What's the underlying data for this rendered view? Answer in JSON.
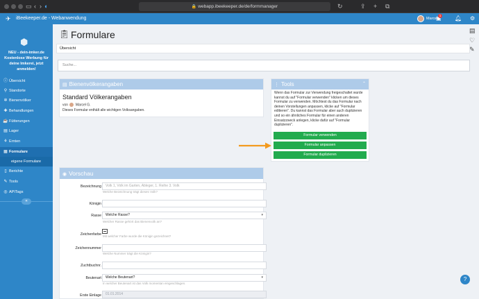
{
  "browser": {
    "url": "webapp.ibeekeeper.de/de/formmanager"
  },
  "header": {
    "app_name": "iBeekeeper.de - Webanwendung",
    "user_name": "Marcel",
    "notification_count": "1"
  },
  "sidebar": {
    "promo": "NEU - dein-imker.de Kostenlose Werbung für deine Imkerei, jetzt anmelden!",
    "items": [
      {
        "label": "Übersicht",
        "icon": "info-icon"
      },
      {
        "label": "Standorte",
        "icon": "map-pin-icon"
      },
      {
        "label": "Bienenvölker",
        "icon": "bee-icon"
      },
      {
        "label": "Behandlungen",
        "icon": "medkit-icon"
      },
      {
        "label": "Fütterungen",
        "icon": "feeding-icon"
      },
      {
        "label": "Lager",
        "icon": "warehouse-icon"
      },
      {
        "label": "Ernten",
        "icon": "harvest-icon"
      },
      {
        "label": "Formulare",
        "icon": "clipboard-icon"
      },
      {
        "label": "eigene Formulare",
        "icon": ""
      },
      {
        "label": "Berichte",
        "icon": "document-icon"
      },
      {
        "label": "Tools",
        "icon": "wrench-icon"
      },
      {
        "label": "APITags",
        "icon": "tag-icon"
      }
    ]
  },
  "main": {
    "title": "Formulare",
    "tab": "Übersicht",
    "search_placeholder": "Suche...",
    "bienen_card": {
      "header": "Bienenvölkerangaben",
      "form_title": "Standard Völkerangaben",
      "from_prefix": "von",
      "author": "Marcel G.",
      "description": "Dieses Formular enthält alle wichtigen Volksangaben."
    },
    "tools_card": {
      "header": "Tools",
      "text": "Wenn das Formular zur Verwendung freigeschaltet wurde kannst du auf \"Formular verwenden\" klicken um dieses Formular zu verwenden. Möchtest du das Formular nach deinen Vorstellungen anpassen, klicke auf \"Formular editieren\". Du kannst das Formular aber auch duplizieren und so ein ähnliches Formular für einen anderen Einsatzzweck anlegen, klicke dafür auf \"Formular duplizieren\".",
      "buttons": [
        "Formular verwenden",
        "Formular anpassen",
        "Formular duplizieren"
      ]
    },
    "preview": {
      "header": "Vorschau",
      "fields": [
        {
          "label": "Bezeichnung",
          "value": "Volk 1, Volk im Garten, Ableger, 1. Reihe 3. Volk",
          "help": "Welche Bezeichnung trägt dieses Volk?"
        },
        {
          "label": "Königin",
          "value": "",
          "help": ""
        },
        {
          "label": "Rasse",
          "value": "Welche Rasse?",
          "help": "Welcher Rasse gehört das Bienenvolk an?"
        },
        {
          "label": "Zeichenfarbe",
          "value": "",
          "help": "Mit welcher Farbe wurde die Königin gezeichnet?"
        },
        {
          "label": "Zeichennummer",
          "value": "",
          "help": "Welche Nummer trägt die Königin?"
        },
        {
          "label": "Zuchtbuchnr.",
          "value": "",
          "help": ""
        },
        {
          "label": "Beutenart",
          "value": "Welche Beutenart?",
          "help": "In welcher Beutenart ist das Volk momentan eingeschlagen."
        },
        {
          "label": "Erste Einlage",
          "value": "01.01.2014",
          "help": ""
        }
      ]
    }
  },
  "help_button": "?"
}
